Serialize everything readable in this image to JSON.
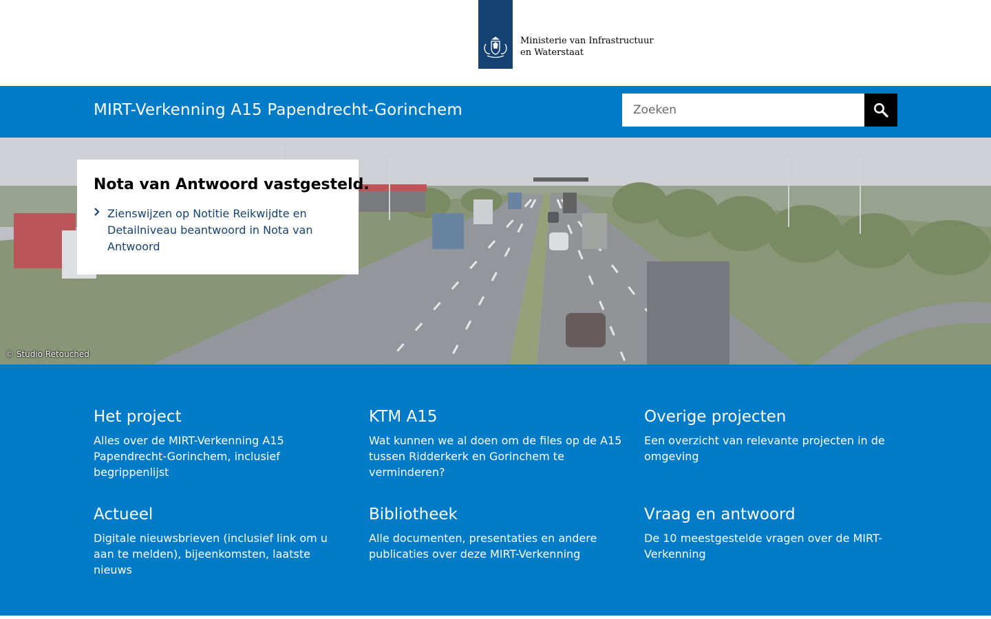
{
  "logo": {
    "line1": "Ministerie van Infrastructuur",
    "line2": "en Waterstaat"
  },
  "header": {
    "site_title": "MIRT-Verkenning A15 Papendrecht-Gorinchem",
    "search_placeholder": "Zoeken",
    "search_icon": "search-icon"
  },
  "hero": {
    "card_title": "Nota van Antwoord vastgesteld.",
    "link_text": "Zienswijzen op Notitie Reikwijdte en Detailniveau beantwoord in Nota van Antwoord",
    "credit": "© Studio Retouched"
  },
  "tiles": [
    {
      "title": "Het project",
      "desc": "Alles over de MIRT-Verkenning A15 Papendrecht-Gorinchem, inclusief begrippenlijst"
    },
    {
      "title": "KTM A15",
      "desc": "Wat kunnen we al doen om de files op de A15 tussen Ridderkerk en Gorinchem te verminderen?"
    },
    {
      "title": "Overige projecten",
      "desc": "Een overzicht van relevante projecten in de omgeving"
    },
    {
      "title": "Actueel",
      "desc": "Digitale nieuwsbrieven (inclusief link om u aan te melden), bijeenkomsten, laatste nieuws"
    },
    {
      "title": "Bibliotheek",
      "desc": "Alle documenten, presentaties en andere publicaties over deze MIRT-Verkenning"
    },
    {
      "title": "Vraag en antwoord",
      "desc": "De 10 meestgestelde vragen over de MIRT-Verkenning"
    }
  ],
  "colors": {
    "brand_blue": "#007bc7",
    "logo_blue": "#154273"
  }
}
